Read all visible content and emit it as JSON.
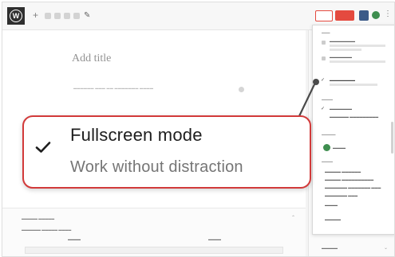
{
  "toolbar": {
    "logo_icon": "wordpress-logo-icon",
    "icons": [
      "plus-icon",
      "undo-icon",
      "redo-icon",
      "info-icon",
      "list-view-icon",
      "edit-icon"
    ],
    "settings_icon": "gear-icon",
    "plugin_icon": "plugin-icon",
    "more_icon": "more-vertical-icon"
  },
  "editor": {
    "title_placeholder": "Add title"
  },
  "highlight": {
    "title": "Fullscreen mode",
    "description": "Work without distraction",
    "checked": true,
    "border_color": "#d23a3a"
  },
  "colors": {
    "publish_button": "#e23b2f",
    "toggle_on": "#2e8540"
  }
}
